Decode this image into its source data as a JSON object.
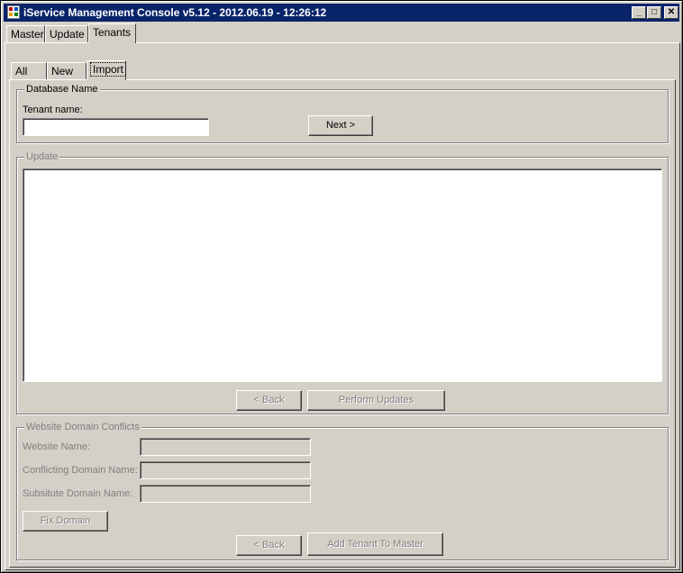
{
  "window": {
    "title": "iService Management Console v5.12 - 2012.06.19 - 12:26:12",
    "minimize_glyph": "_",
    "maximize_glyph": "□",
    "close_glyph": "✕"
  },
  "main_tabs": [
    {
      "label": "Master"
    },
    {
      "label": "Update"
    },
    {
      "label": "Tenants",
      "selected": true
    }
  ],
  "sub_tabs": [
    {
      "label": "All"
    },
    {
      "label": "New"
    },
    {
      "label": "Import",
      "selected": true
    }
  ],
  "database": {
    "group_title": "Database Name",
    "tenant_label": "Tenant name:",
    "tenant_value": "",
    "next_label": "Next >"
  },
  "update": {
    "group_title": "Update",
    "log_text": "",
    "back_label": "< Back",
    "perform_label": "Perform Updates"
  },
  "conflicts": {
    "group_title": "Website Domain Conflicts",
    "website_label": "Website Name:",
    "website_value": "",
    "conflicting_label": "Conflicting Domain Name:",
    "conflicting_value": "",
    "substitute_label": "Subsitute Domain Name:",
    "substitute_value": "",
    "fix_label": "Fix Domain",
    "back_label": "< Back",
    "add_label": "Add Tenant To Master"
  },
  "colors": {
    "titlebar": "#0a246a",
    "face": "#d4d0c8",
    "disabled_text": "#808080"
  }
}
